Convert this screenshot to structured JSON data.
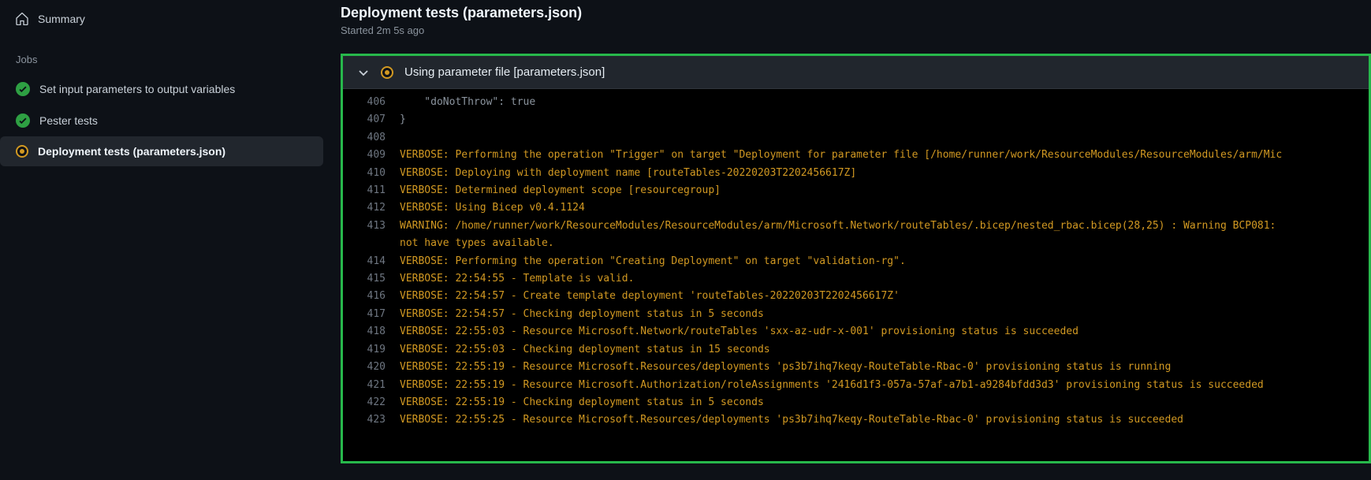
{
  "sidebar": {
    "summary_label": "Summary",
    "jobs_heading": "Jobs",
    "jobs": [
      {
        "label": "Set input parameters to output variables",
        "status": "success"
      },
      {
        "label": "Pester tests",
        "status": "success"
      },
      {
        "label": "Deployment tests (parameters.json)",
        "status": "running"
      }
    ]
  },
  "header": {
    "title": "Deployment tests (parameters.json)",
    "subtitle": "Started 2m 5s ago"
  },
  "step": {
    "title": "Using parameter file [parameters.json]"
  },
  "log": [
    {
      "num": 406,
      "cls": "",
      "text": "    \"doNotThrow\": true"
    },
    {
      "num": 407,
      "cls": "",
      "text": "}"
    },
    {
      "num": 408,
      "cls": "",
      "text": ""
    },
    {
      "num": 409,
      "cls": "warn",
      "text": "VERBOSE: Performing the operation \"Trigger\" on target \"Deployment for parameter file [/home/runner/work/ResourceModules/ResourceModules/arm/Mic"
    },
    {
      "num": 410,
      "cls": "warn",
      "text": "VERBOSE: Deploying with deployment name [routeTables-20220203T2202456617Z]"
    },
    {
      "num": 411,
      "cls": "warn",
      "text": "VERBOSE: Determined deployment scope [resourcegroup]"
    },
    {
      "num": 412,
      "cls": "warn",
      "text": "VERBOSE: Using Bicep v0.4.1124"
    },
    {
      "num": 413,
      "cls": "warn",
      "text": "WARNING: /home/runner/work/ResourceModules/ResourceModules/arm/Microsoft.Network/routeTables/.bicep/nested_rbac.bicep(28,25) : Warning BCP081: "
    },
    {
      "num": "",
      "cls": "warn",
      "text": "not have types available."
    },
    {
      "num": 414,
      "cls": "warn",
      "text": "VERBOSE: Performing the operation \"Creating Deployment\" on target \"validation-rg\"."
    },
    {
      "num": 415,
      "cls": "warn",
      "text": "VERBOSE: 22:54:55 - Template is valid."
    },
    {
      "num": 416,
      "cls": "warn",
      "text": "VERBOSE: 22:54:57 - Create template deployment 'routeTables-20220203T2202456617Z'"
    },
    {
      "num": 417,
      "cls": "warn",
      "text": "VERBOSE: 22:54:57 - Checking deployment status in 5 seconds"
    },
    {
      "num": 418,
      "cls": "warn",
      "text": "VERBOSE: 22:55:03 - Resource Microsoft.Network/routeTables 'sxx-az-udr-x-001' provisioning status is succeeded"
    },
    {
      "num": 419,
      "cls": "warn",
      "text": "VERBOSE: 22:55:03 - Checking deployment status in 15 seconds"
    },
    {
      "num": 420,
      "cls": "warn",
      "text": "VERBOSE: 22:55:19 - Resource Microsoft.Resources/deployments 'ps3b7ihq7keqy-RouteTable-Rbac-0' provisioning status is running"
    },
    {
      "num": 421,
      "cls": "warn",
      "text": "VERBOSE: 22:55:19 - Resource Microsoft.Authorization/roleAssignments '2416d1f3-057a-57af-a7b1-a9284bfdd3d3' provisioning status is succeeded"
    },
    {
      "num": 422,
      "cls": "warn",
      "text": "VERBOSE: 22:55:19 - Checking deployment status in 5 seconds"
    },
    {
      "num": 423,
      "cls": "warn",
      "text": "VERBOSE: 22:55:25 - Resource Microsoft.Resources/deployments 'ps3b7ihq7keqy-RouteTable-Rbac-0' provisioning status is succeeded"
    }
  ]
}
